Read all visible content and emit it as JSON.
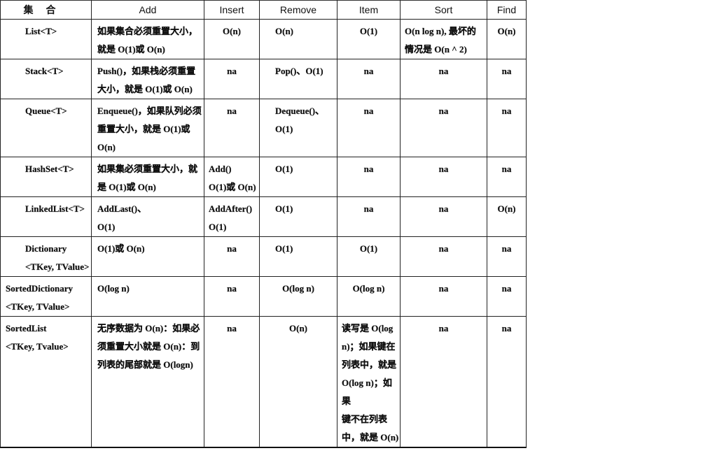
{
  "table": {
    "headers": [
      "集合",
      "Add",
      "Insert",
      "Remove",
      "Item",
      "Sort",
      "Find"
    ],
    "rows": [
      [
        "List<T>",
        "如果集合必须重置大小，\n就是 O(1)或 O(n)",
        "O(n)",
        "O(n)",
        "O(1)",
        "O(n  log  n), 最坏的\n情况是 O(n ^ 2)",
        "O(n)"
      ],
      [
        "Stack<T>",
        "Push()，如果栈必须重置\n大小，就是 O(1)或 O(n)",
        "na",
        "Pop()、O(1)",
        "na",
        "na",
        "na"
      ],
      [
        "Queue<T>",
        "Enqueue()，如果队列必须\n重置大小，就是 O(1)或\nO(n)",
        "na",
        "Dequeue()、\nO(1)",
        "na",
        "na",
        "na"
      ],
      [
        "HashSet<T>",
        "如果集必须重置大小，就\n是 O(1)或 O(n)",
        "Add()\nO(1)或 O(n)",
        "O(1)",
        "na",
        "na",
        "na"
      ],
      [
        "LinkedList<T>",
        "AddLast()、\nO(1)",
        "AddAfter()\nO(1)",
        "O(1)",
        "na",
        "na",
        "O(n)"
      ],
      [
        "Dictionary\n<TKey, TValue>",
        "O(1)或 O(n)",
        "na",
        "O(1)",
        "O(1)",
        "na",
        "na"
      ],
      [
        "SortedDictionary\n<TKey, TValue>",
        "O(log n)",
        "na",
        "O(log n)",
        "O(log n)",
        "na",
        "na"
      ],
      [
        "SortedList\n<TKey, Tvalue>",
        "无序数据为 O(n)：如果必\n须重置大小就是 O(n)：到\n列表的尾部就是  O(logn)",
        "na",
        "O(n)",
        "读写是  O(log\nn)；如果键在\n列表中，就是\nO(log n)；如果\n键不在列表\n中，就是 O(n)",
        "na",
        "na"
      ]
    ]
  }
}
